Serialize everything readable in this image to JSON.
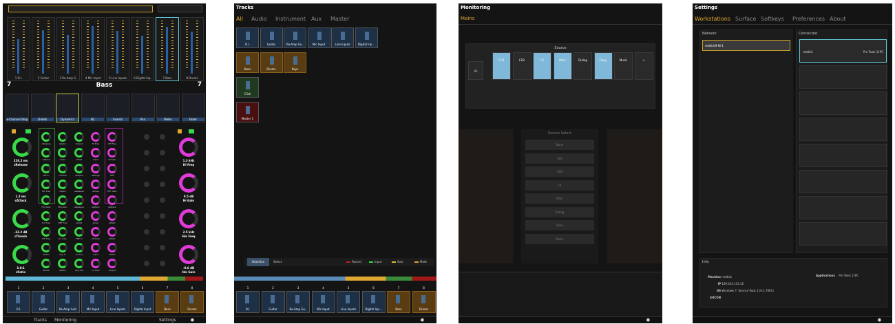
{
  "panel1": {
    "channels": [
      "1 D.I.",
      "2 Guitar",
      "3 Re-Amp G.",
      "4 Mic Input",
      "5 Line Inputs",
      "6 Digital Inp.",
      "7 Bass",
      "8 Drums"
    ],
    "track_number_left": "7",
    "track_name": "Bass",
    "track_number_right": "7",
    "inserts": [
      "e-Channel Strip",
      "D-Verb",
      "Dynamics",
      "EQ",
      "Inserts",
      "Pan",
      "Meter",
      "Fader"
    ],
    "left_knobs": [
      {
        "value": "228.2 ms",
        "label": "cRelease"
      },
      {
        "value": "1.2 ms",
        "label": "cAttack"
      },
      {
        "value": "-32.2 dB",
        "label": "cThresh"
      },
      {
        "value": "3.0:1",
        "label": "cRatio"
      }
    ],
    "right_knobs": [
      {
        "value": "1.3 kHz",
        "label": "HI Freq"
      },
      {
        "value": "0.5 dB",
        "label": "Hi Gain"
      },
      {
        "value": "2.5 kHz",
        "label": "Hm Freq"
      },
      {
        "value": "-0.6 dB",
        "label": "Hm Gain"
      }
    ],
    "grid_labels": [
      "cRelease",
      "eKydro",
      "Output",
      "HI Freq",
      "LTF Freq",
      "cAttack",
      "cGain",
      "eHold",
      "Input",
      "Hi Gain",
      "LPF In",
      "cThresh",
      "eDepth",
      "eRange",
      "HPF",
      "Hm Freq",
      "cRatio",
      "eRelease",
      "eKnee",
      "HPF Gain",
      "Hm Gain",
      "Mid Gain",
      "eRelease",
      "eAttack",
      "eAttack",
      "Lm Freq",
      "HPF Freq",
      "eHold",
      "eGain",
      "eRatio",
      "LTF Freq",
      "Lm Gain",
      "HPF In",
      "eThresh",
      "eRatio",
      "eRatio",
      "Key In",
      "Lo Freq",
      "Input",
      "eRatio",
      "eKnee",
      "eRatio",
      "Key List",
      "Lo Gain",
      "Output"
    ],
    "bottom_numbers": [
      "1",
      "2",
      "3",
      "4",
      "5",
      "6",
      "7",
      "8"
    ],
    "bottom_tracks": [
      "D.I.",
      "Guitar",
      "Re-Amp Guit.",
      "Mic Input",
      "Line Inputs",
      "Digital Input",
      "Bass",
      "Drums"
    ],
    "nav": {
      "tracks": "Tracks",
      "monitoring": "Monitoring",
      "settings": "Settings"
    }
  },
  "panel2": {
    "title": "Tracks",
    "tabs": [
      "All",
      "Audio",
      "Instrument",
      "Aux",
      "Master"
    ],
    "row1": [
      "D.I.",
      "Guitar",
      "Re-Amp Gu..",
      "Mic Input",
      "Line Inputs",
      "Digital Inp..."
    ],
    "row2": [
      "Bass",
      "Drums",
      "Keys"
    ],
    "row3": [
      "Click"
    ],
    "row4": [
      "Master 1"
    ],
    "footer_left": [
      "Attention",
      "Select"
    ],
    "legend": [
      "Record",
      "Input",
      "Solo",
      "Mute"
    ],
    "bottom_numbers": [
      "1",
      "2",
      "3",
      "4",
      "5",
      "6",
      "7",
      "8"
    ],
    "bottom_tracks": [
      "D.I.",
      "Guitar",
      "Re-Amp Gu..",
      "Mic Input",
      "Line Inputs",
      "Digital Inp...",
      "Bass",
      "Drums"
    ]
  },
  "panel3": {
    "title": "Monitoring",
    "sub": "Mains",
    "source_label": "Source",
    "all_label": "All",
    "sources": [
      "CD1",
      "CD2",
      "FX",
      "Main",
      "Dialog",
      "Foley",
      "Music",
      "+"
    ],
    "source_select_label": "Source Select",
    "source_select": [
      "None",
      "CD1",
      "CD2",
      "FX",
      "Main",
      "Dialog",
      "Foley",
      "Music"
    ]
  },
  "panel4": {
    "title": "Settings",
    "tabs": [
      "Workstations",
      "Surface",
      "Softkeys",
      "Preferences",
      "About"
    ],
    "network_label": "Network",
    "network_item": "reddick9-Ni-1",
    "connected_label": "Connected",
    "connected_name": "reddick",
    "connected_app": "Pro Tools 11PC",
    "info_label": "Info",
    "info": {
      "machine_label": "Machine",
      "machine": "reddick",
      "ip_label": "IP",
      "ip": "169.254.113.16",
      "os_label": "OS",
      "os": "Windows 7, Service Pack 1 (6.1.7601)",
      "eucon_label": "EUCON",
      "apps_label": "Applications",
      "apps": "Pro Tools 11PC"
    }
  },
  "colors": {
    "accent": "#e0a830",
    "bg": "#141414",
    "blue": "#1d3046",
    "gold": "#5a3c12"
  }
}
